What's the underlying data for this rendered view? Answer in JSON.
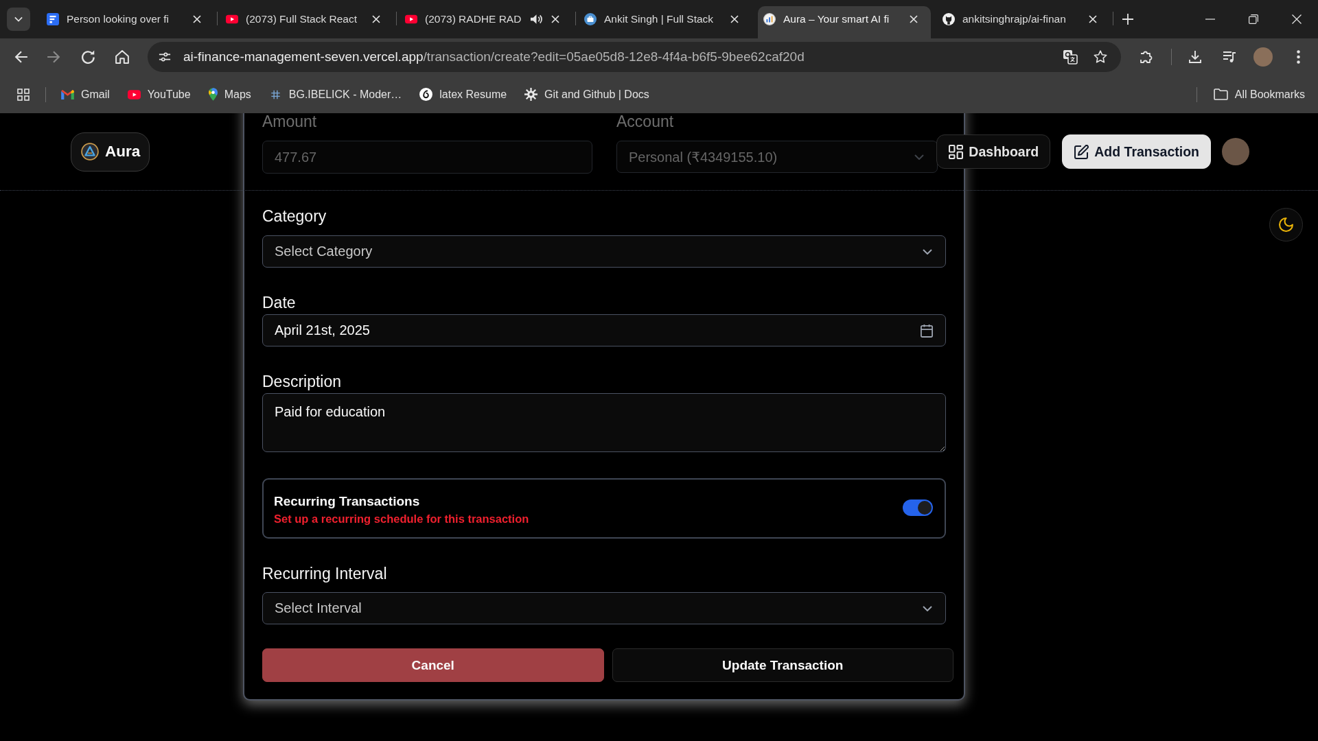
{
  "browser": {
    "tabs": [
      {
        "title": "Person looking over fi",
        "selected": false,
        "audio": false
      },
      {
        "title": "(2073) Full Stack React",
        "selected": false,
        "audio": false
      },
      {
        "title": "(2073) RADHE RAD",
        "selected": false,
        "audio": true
      },
      {
        "title": "Ankit Singh | Full Stack",
        "selected": false,
        "audio": false
      },
      {
        "title": "Aura – Your smart AI fi",
        "selected": true,
        "audio": false
      },
      {
        "title": "ankitsinghrajp/ai-finan",
        "selected": false,
        "audio": false
      }
    ],
    "forward": {
      "disabled": true
    },
    "address": {
      "host": "ai-finance-management-seven.vercel.app",
      "path": "/transaction/create?edit=05ae05d8-12e8-4f4a-b6f5-9bee62caf20d"
    },
    "bookmarks": [
      "Gmail",
      "YouTube",
      "Maps",
      "BG.IBELICK - Moder…",
      "latex Resume",
      "Git and Github | Docs"
    ],
    "all_bookmarks": "All Bookmarks"
  },
  "header": {
    "brand": "Aura",
    "nav": [
      {
        "label": "Dashboard",
        "kind": "outline"
      },
      {
        "label": "Add Transaction",
        "kind": "primary"
      }
    ]
  },
  "form": {
    "amount": {
      "label": "Amount",
      "value": "477.67"
    },
    "account": {
      "label": "Account",
      "value": "Personal (₹4349155.10)"
    },
    "category": {
      "label": "Category",
      "placeholder": "Select Category"
    },
    "date": {
      "label": "Date",
      "value": "April 21st, 2025"
    },
    "description": {
      "label": "Description",
      "value": "Paid for education"
    },
    "recurring": {
      "title": "Recurring Transactions",
      "hint": "Set up a recurring schedule for this transaction",
      "on": true
    },
    "interval": {
      "label": "Recurring Interval",
      "placeholder": "Select Interval"
    },
    "actions": [
      {
        "label": "Cancel",
        "kind": "destructive"
      },
      {
        "label": "Update Transaction",
        "kind": "outline"
      }
    ]
  }
}
